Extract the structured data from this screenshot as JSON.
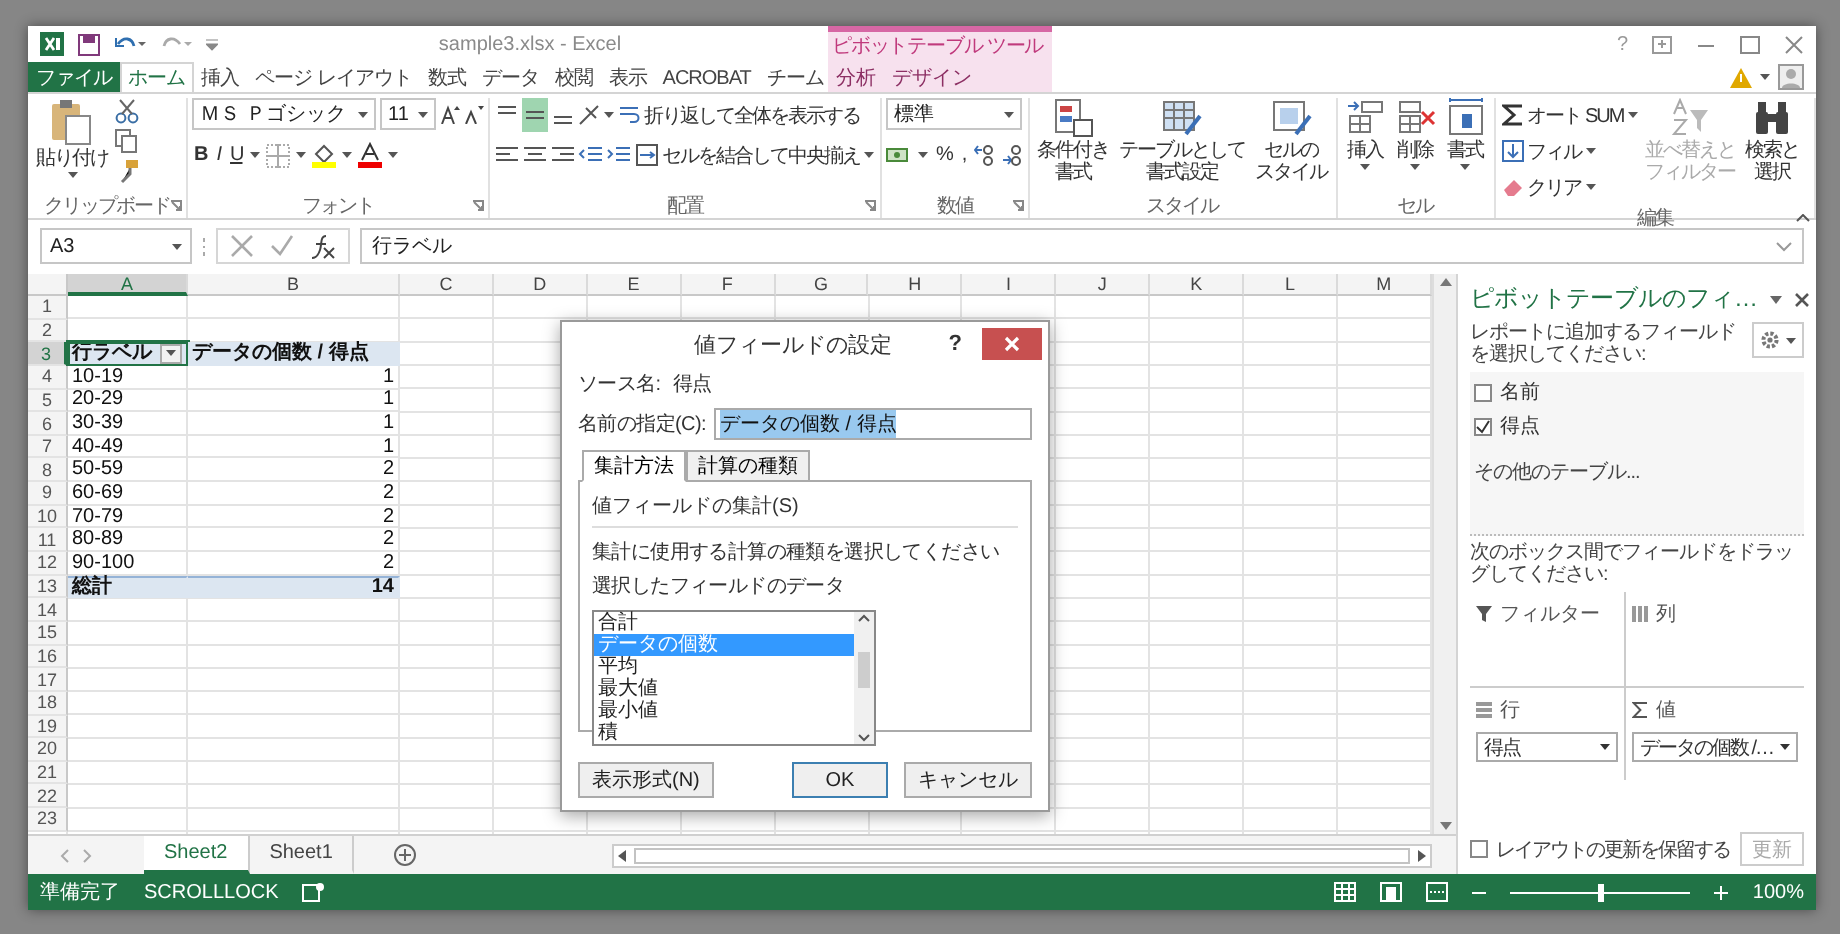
{
  "window": {
    "title": "sample3.xlsx - Excel",
    "context_group": "ピボットテーブル ツール",
    "help": "?"
  },
  "ribbon_tabs": [
    {
      "label": "ファイル",
      "kind": "file",
      "selected": false
    },
    {
      "label": "ホーム",
      "kind": "tab",
      "selected": true
    },
    {
      "label": "挿入",
      "kind": "tab",
      "selected": false
    },
    {
      "label": "ページ レイアウト",
      "kind": "tab",
      "selected": false
    },
    {
      "label": "数式",
      "kind": "tab",
      "selected": false
    },
    {
      "label": "データ",
      "kind": "tab",
      "selected": false
    },
    {
      "label": "校閲",
      "kind": "tab",
      "selected": false
    },
    {
      "label": "表示",
      "kind": "tab",
      "selected": false
    },
    {
      "label": "ACROBAT",
      "kind": "tab",
      "selected": false
    },
    {
      "label": "チーム",
      "kind": "tab",
      "selected": false
    }
  ],
  "context_tabs": [
    {
      "label": "分析",
      "selected": false
    },
    {
      "label": "デザイン",
      "selected": false
    }
  ],
  "ribbon": {
    "clipboard": {
      "label": "クリップボード",
      "paste": "貼り付け"
    },
    "font": {
      "label": "フォント",
      "name": "ＭＳ Ｐゴシック",
      "size": "11",
      "styles": [
        "B",
        "I",
        "U"
      ]
    },
    "alignment": {
      "label": "配置",
      "vertical": [
        {
          "selected": false
        },
        {
          "selected": true
        },
        {
          "selected": false
        }
      ],
      "wrap": "折り返して全体を表示する",
      "merge": "セルを結合して中央揃え"
    },
    "number": {
      "label": "数値",
      "format": "標準",
      "symbols": [
        "%",
        ","
      ]
    },
    "styles": {
      "label": "スタイル",
      "buttons": [
        {
          "kind": "conditional",
          "lines": [
            "条件付き",
            "書式"
          ]
        },
        {
          "kind": "table",
          "lines": [
            "テーブルとして",
            "書式設定"
          ]
        },
        {
          "kind": "cellstyle",
          "lines": [
            "セルの",
            "スタイル"
          ]
        }
      ]
    },
    "cells": {
      "label": "セル",
      "buttons": [
        {
          "kind": "insert",
          "label": "挿入"
        },
        {
          "kind": "delete",
          "label": "削除"
        },
        {
          "kind": "format",
          "label": "書式"
        }
      ]
    },
    "editing": {
      "label": "編集",
      "items": [
        {
          "kind": "sum",
          "label": "オート SUM"
        },
        {
          "kind": "fill",
          "label": "フィル"
        },
        {
          "kind": "clear",
          "label": "クリア"
        }
      ],
      "big": [
        {
          "kind": "sort",
          "lines": [
            "並べ替えと",
            "フィルター"
          ],
          "disabled": true
        },
        {
          "kind": "find",
          "lines": [
            "検索と",
            "選択"
          ],
          "disabled": false
        }
      ]
    }
  },
  "formula_bar": {
    "name_box": "A3",
    "formula": "行ラベル"
  },
  "sheet": {
    "columns": [
      {
        "label": "A",
        "selected": true
      },
      {
        "label": "B",
        "selected": false
      },
      {
        "label": "C",
        "selected": false
      },
      {
        "label": "D",
        "selected": false
      },
      {
        "label": "E",
        "selected": false
      },
      {
        "label": "F",
        "selected": false
      },
      {
        "label": "G",
        "selected": false
      },
      {
        "label": "H",
        "selected": false
      },
      {
        "label": "I",
        "selected": false
      },
      {
        "label": "J",
        "selected": false
      },
      {
        "label": "K",
        "selected": false
      },
      {
        "label": "L",
        "selected": false
      },
      {
        "label": "M",
        "selected": false
      }
    ],
    "rows": [
      {
        "number": "1",
        "selected": false,
        "kind": "empty"
      },
      {
        "number": "2",
        "selected": false,
        "kind": "empty"
      },
      {
        "number": "3",
        "selected": true,
        "kind": "header",
        "cells": [
          {
            "text": "行ラベル",
            "selected": true
          },
          {
            "text": "データの個数 / 得点",
            "selected": false
          }
        ]
      },
      {
        "number": "4",
        "selected": false,
        "kind": "item",
        "cells": [
          {
            "text": "10-19",
            "selected": false
          },
          {
            "text": "1",
            "selected": false
          }
        ]
      },
      {
        "number": "5",
        "selected": false,
        "kind": "item",
        "cells": [
          {
            "text": "20-29",
            "selected": false
          },
          {
            "text": "1",
            "selected": false
          }
        ]
      },
      {
        "number": "6",
        "selected": false,
        "kind": "item",
        "cells": [
          {
            "text": "30-39",
            "selected": false
          },
          {
            "text": "1",
            "selected": false
          }
        ]
      },
      {
        "number": "7",
        "selected": false,
        "kind": "item",
        "cells": [
          {
            "text": "40-49",
            "selected": false
          },
          {
            "text": "1",
            "selected": false
          }
        ]
      },
      {
        "number": "8",
        "selected": false,
        "kind": "item",
        "cells": [
          {
            "text": "50-59",
            "selected": false
          },
          {
            "text": "2",
            "selected": false
          }
        ]
      },
      {
        "number": "9",
        "selected": false,
        "kind": "item",
        "cells": [
          {
            "text": "60-69",
            "selected": false
          },
          {
            "text": "2",
            "selected": false
          }
        ]
      },
      {
        "number": "10",
        "selected": false,
        "kind": "item",
        "cells": [
          {
            "text": "70-79",
            "selected": false
          },
          {
            "text": "2",
            "selected": false
          }
        ]
      },
      {
        "number": "11",
        "selected": false,
        "kind": "item",
        "cells": [
          {
            "text": "80-89",
            "selected": false
          },
          {
            "text": "2",
            "selected": false
          }
        ]
      },
      {
        "number": "12",
        "selected": false,
        "kind": "item",
        "cells": [
          {
            "text": "90-100",
            "selected": false
          },
          {
            "text": "2",
            "selected": false
          }
        ]
      },
      {
        "number": "13",
        "selected": false,
        "kind": "total",
        "cells": [
          {
            "text": "総計",
            "selected": false
          },
          {
            "text": "14",
            "selected": false
          }
        ]
      },
      {
        "number": "14",
        "selected": false,
        "kind": "empty"
      },
      {
        "number": "15",
        "selected": false,
        "kind": "empty"
      },
      {
        "number": "16",
        "selected": false,
        "kind": "empty"
      },
      {
        "number": "17",
        "selected": false,
        "kind": "empty"
      },
      {
        "number": "18",
        "selected": false,
        "kind": "empty"
      },
      {
        "number": "19",
        "selected": false,
        "kind": "empty"
      },
      {
        "number": "20",
        "selected": false,
        "kind": "empty"
      },
      {
        "number": "21",
        "selected": false,
        "kind": "empty"
      },
      {
        "number": "22",
        "selected": false,
        "kind": "empty"
      },
      {
        "number": "23",
        "selected": false,
        "kind": "empty"
      }
    ],
    "tabs": [
      {
        "label": "Sheet2",
        "selected": true
      },
      {
        "label": "Sheet1",
        "selected": false
      }
    ]
  },
  "dialog": {
    "title": "値フィールドの設定",
    "help": "?",
    "source_label": "ソース名:",
    "source": "得点",
    "name_label": "名前の指定(C):",
    "name_value": "データの個数 / 得点",
    "tabs": [
      {
        "label": "集計方法",
        "selected": true
      },
      {
        "label": "計算の種類",
        "selected": false
      }
    ],
    "section": "値フィールドの集計(S)",
    "description": "集計に使用する計算の種類を選択してください",
    "list_label": "選択したフィールドのデータ",
    "functions": [
      {
        "label": "合計",
        "selected": false
      },
      {
        "label": "データの個数",
        "selected": true
      },
      {
        "label": "平均",
        "selected": false
      },
      {
        "label": "最大値",
        "selected": false
      },
      {
        "label": "最小値",
        "selected": false
      },
      {
        "label": "積",
        "selected": false
      }
    ],
    "buttons": [
      {
        "label": "表示形式(N)",
        "kind": "format"
      },
      {
        "label": "OK",
        "kind": "default"
      },
      {
        "label": "キャンセル",
        "kind": "cancel"
      }
    ]
  },
  "pivot_pane": {
    "title": "ピボットテーブルのフィ…",
    "instruction": "レポートに追加するフィールドを選択してください:",
    "fields": [
      {
        "label": "名前",
        "checked": false
      },
      {
        "label": "得点",
        "checked": true
      }
    ],
    "more_tables": "その他のテーブル...",
    "drag_hint": "次のボックス間でフィールドをドラッグしてください:",
    "areas": [
      {
        "kind": "filter",
        "label": "フィルター"
      },
      {
        "kind": "columns",
        "label": "列"
      },
      {
        "kind": "rows",
        "label": "行",
        "chip": "得点"
      },
      {
        "kind": "values",
        "label": "値",
        "chip": "データの個数 /…"
      }
    ],
    "defer": {
      "label": "レイアウトの更新を保留する",
      "checked": false
    },
    "update": {
      "label": "更新",
      "disabled": true
    }
  },
  "status_bar": {
    "ready": "準備完了",
    "scroll_lock": "SCROLLLOCK",
    "zoom": {
      "level": 0.5
    },
    "zoom_text": "100%"
  }
}
